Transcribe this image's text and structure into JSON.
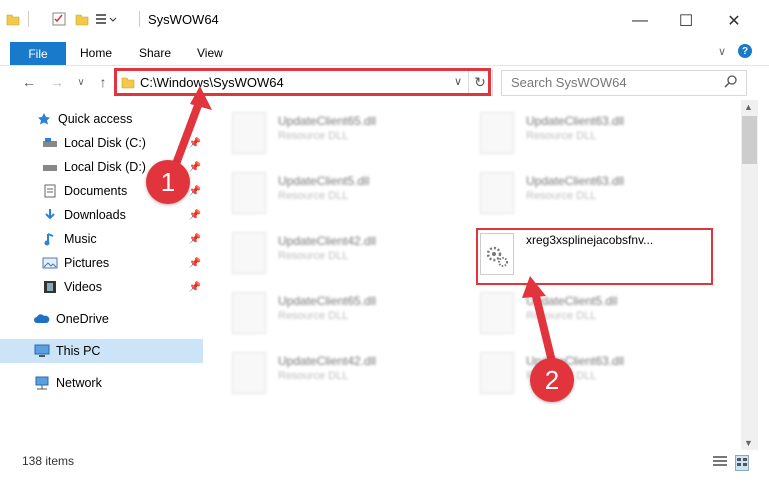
{
  "window": {
    "title": "SysWOW64",
    "minimize": "—",
    "maximize": "☐",
    "close": "✕"
  },
  "ribbon": {
    "tabs": [
      "File",
      "Home",
      "Share",
      "View"
    ],
    "collapse": "∨",
    "help": "?"
  },
  "nav": {
    "back": "←",
    "forward": "→",
    "recent": "∨",
    "up": "↑"
  },
  "address": {
    "path": "C:\\Windows\\SysWOW64",
    "dropdown": "∨",
    "refresh": "↻"
  },
  "search": {
    "placeholder": "Search SysWOW64"
  },
  "sidebar": {
    "items": [
      {
        "label": "Quick access",
        "icon": "star-icon",
        "pinned": false
      },
      {
        "label": "Local Disk (C:)",
        "icon": "drive-icon",
        "pinned": true
      },
      {
        "label": "Local Disk (D:)",
        "icon": "drive-icon",
        "pinned": true
      },
      {
        "label": "Documents",
        "icon": "documents-icon",
        "pinned": true
      },
      {
        "label": "Downloads",
        "icon": "downloads-icon",
        "pinned": true
      },
      {
        "label": "Music",
        "icon": "music-icon",
        "pinned": true
      },
      {
        "label": "Pictures",
        "icon": "pictures-icon",
        "pinned": true
      },
      {
        "label": "Videos",
        "icon": "videos-icon",
        "pinned": true
      },
      {
        "label": "OneDrive",
        "icon": "cloud-icon",
        "pinned": false
      },
      {
        "label": "This PC",
        "icon": "computer-icon",
        "pinned": false
      },
      {
        "label": "Network",
        "icon": "network-icon",
        "pinned": false
      }
    ]
  },
  "files": [
    {
      "name": "UpdateClient65.dll",
      "type": "Resource DLL"
    },
    {
      "name": "UpdateClient63.dll",
      "type": "Resource DLL"
    },
    {
      "name": "UpdateClient5.dll",
      "type": "Resource DLL"
    },
    {
      "name": "UpdateClient63.dll",
      "type": "Resource DLL"
    },
    {
      "name": "UpdateClient42.dll",
      "type": "Resource DLL"
    },
    {
      "name": "xreg3xsplinejacobsfnv...",
      "type": ""
    },
    {
      "name": "UpdateClient65.dll",
      "type": "Resource DLL"
    },
    {
      "name": "UpdateClient5.dll",
      "type": "Resource DLL"
    },
    {
      "name": "UpdateClient42.dll",
      "type": "Resource DLL"
    },
    {
      "name": "UpdateClient63.dll",
      "type": "Resource DLL"
    }
  ],
  "status": {
    "count": "138 items"
  },
  "callouts": [
    "1",
    "2"
  ],
  "colors": {
    "accent": "#1979ca",
    "highlight": "#e2343c"
  }
}
